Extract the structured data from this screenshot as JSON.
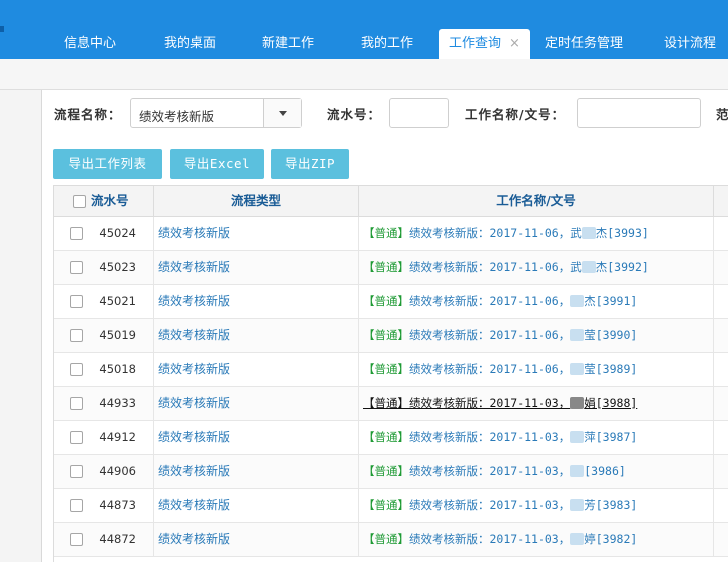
{
  "tabs": [
    {
      "label": "信息中心"
    },
    {
      "label": "我的桌面"
    },
    {
      "label": "新建工作"
    },
    {
      "label": "我的工作"
    },
    {
      "label": "工作查询",
      "close": "×"
    },
    {
      "label": "定时任务管理"
    },
    {
      "label": "设计流程"
    }
  ],
  "filters": {
    "flow_name_label": "流程名称：",
    "flow_name_value": "绩效考核新版",
    "serial_label": "流水号：",
    "work_name_label": "工作名称/文号：",
    "range_label": "范"
  },
  "actions": {
    "export_list": "导出工作列表",
    "export_excel": "导出Excel",
    "export_zip": "导出ZIP"
  },
  "table": {
    "headers": {
      "id": "流水号",
      "type": "流程类型",
      "name": "工作名称/文号"
    },
    "rows": [
      {
        "id": "45024",
        "type": "绩效考核新版",
        "tag": "【普通】",
        "prefix": "绩效考核新版：2017-11-06，武",
        "suffix": "杰[3993]"
      },
      {
        "id": "45023",
        "type": "绩效考核新版",
        "tag": "【普通】",
        "prefix": "绩效考核新版：2017-11-06，武",
        "suffix": "杰[3992]"
      },
      {
        "id": "45021",
        "type": "绩效考核新版",
        "tag": "【普通】",
        "prefix": "绩效考核新版：2017-11-06，",
        "suffix": "杰[3991]"
      },
      {
        "id": "45019",
        "type": "绩效考核新版",
        "tag": "【普通】",
        "prefix": "绩效考核新版：2017-11-06，",
        "suffix": "莹[3990]"
      },
      {
        "id": "45018",
        "type": "绩效考核新版",
        "tag": "【普通】",
        "prefix": "绩效考核新版：2017-11-06，",
        "suffix": "莹[3989]"
      },
      {
        "id": "44933",
        "type": "绩效考核新版",
        "tag": "【普通】",
        "prefix": "绩效考核新版：2017-11-03，",
        "suffix": "娟[3988]"
      },
      {
        "id": "44912",
        "type": "绩效考核新版",
        "tag": "【普通】",
        "prefix": "绩效考核新版：2017-11-03，",
        "suffix": "萍[3987]"
      },
      {
        "id": "44906",
        "type": "绩效考核新版",
        "tag": "【普通】",
        "prefix": "绩效考核新版：2017-11-03，",
        "suffix": "[3986]"
      },
      {
        "id": "44873",
        "type": "绩效考核新版",
        "tag": "【普通】",
        "prefix": "绩效考核新版：2017-11-03，",
        "suffix": "芳[3983]"
      },
      {
        "id": "44872",
        "type": "绩效考核新版",
        "tag": "【普通】",
        "prefix": "绩效考核新版：2017-11-03，",
        "suffix": "婷[3982]"
      }
    ]
  },
  "colors": {
    "topbar": "#1f8be0",
    "button": "#5bc0de",
    "link": "#2a7ab8",
    "tag_green": "#1e9a34"
  }
}
